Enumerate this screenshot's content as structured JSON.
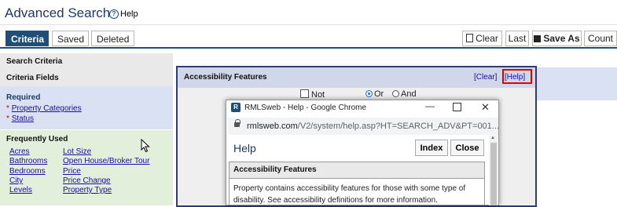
{
  "header": {
    "title": "Advanced Search",
    "help_label": "Help"
  },
  "tabs": [
    {
      "label": "Criteria"
    },
    {
      "label": "Saved"
    },
    {
      "label": "Deleted"
    }
  ],
  "toolbar": {
    "clear": "Clear",
    "last": "Last",
    "save_as": "Save As",
    "count": "Count"
  },
  "left": {
    "search_criteria": "Search Criteria",
    "criteria_fields": "Criteria Fields",
    "required_label": "Required",
    "required_items": [
      "Property Categories",
      "Status"
    ],
    "frequent_label": "Frequently Used",
    "frequent_items": [
      [
        "Acres",
        "Lot Size"
      ],
      [
        "Bathrooms",
        "Open House/Broker Tour"
      ],
      [
        "Bedrooms",
        "Price"
      ],
      [
        "City",
        "Price Change"
      ],
      [
        "Levels",
        "Property Type"
      ]
    ]
  },
  "accessibility": {
    "title": "Accessibility Features",
    "clear_link": "[Clear]",
    "help_link": "[Help]",
    "not_label": "Not",
    "or_label": "Or",
    "and_label": "And",
    "selected_mode": "Or"
  },
  "popup": {
    "window_title": "RMLSweb - Help - Google Chrome",
    "logo_text": "R",
    "url_host": "rmlsweb.com",
    "url_path": "/V2/system/help.asp?HT=SEARCH_ADV&PT=001...",
    "heading": "Help",
    "index_button": "Index",
    "close_button": "Close",
    "card_title": "Accessibility Features",
    "card_text": "Property contains accessibility features for those with some type of disability. See accessibility definitions for more information."
  }
}
